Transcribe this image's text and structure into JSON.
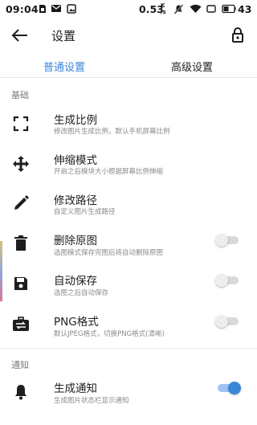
{
  "status_bar": {
    "time": "09:04",
    "speed": "0.53",
    "speed_unit_top": "K",
    "speed_unit_bottom": "/s",
    "battery": "43"
  },
  "app_bar": {
    "title": "设置"
  },
  "tabs": {
    "normal": "普通设置",
    "advanced": "高级设置",
    "active_color": "#3a86d8"
  },
  "sections": {
    "basic": "基础",
    "notify": "通知"
  },
  "rows": {
    "ratio": {
      "title": "生成比例",
      "sub": "修改图片生成比例，默认手机屏幕比例",
      "icon": "fullscreen-corners-icon"
    },
    "stretch": {
      "title": "伸缩模式",
      "sub": "开启之后模块大小根据屏幕比例伸缩",
      "icon": "move-arrows-icon"
    },
    "path": {
      "title": "修改路径",
      "sub": "自定义图片生成路径",
      "icon": "pencil-icon"
    },
    "delete_original": {
      "title": "删除原图",
      "sub": "选图模式保存完图后将自动删除原图",
      "icon": "trash-icon",
      "enabled": false
    },
    "auto_save": {
      "title": "自动保存",
      "sub": "选图之后自动保存",
      "icon": "save-icon",
      "enabled": false
    },
    "png_format": {
      "title": "PNG格式",
      "sub": "默认JPEG格式，切换PNG格式(清晰)",
      "icon": "swap-briefcase-icon",
      "enabled": false
    },
    "gen_notify": {
      "title": "生成通知",
      "sub": "生成图片状态栏显示通知",
      "icon": "bell-icon",
      "enabled": true
    }
  }
}
